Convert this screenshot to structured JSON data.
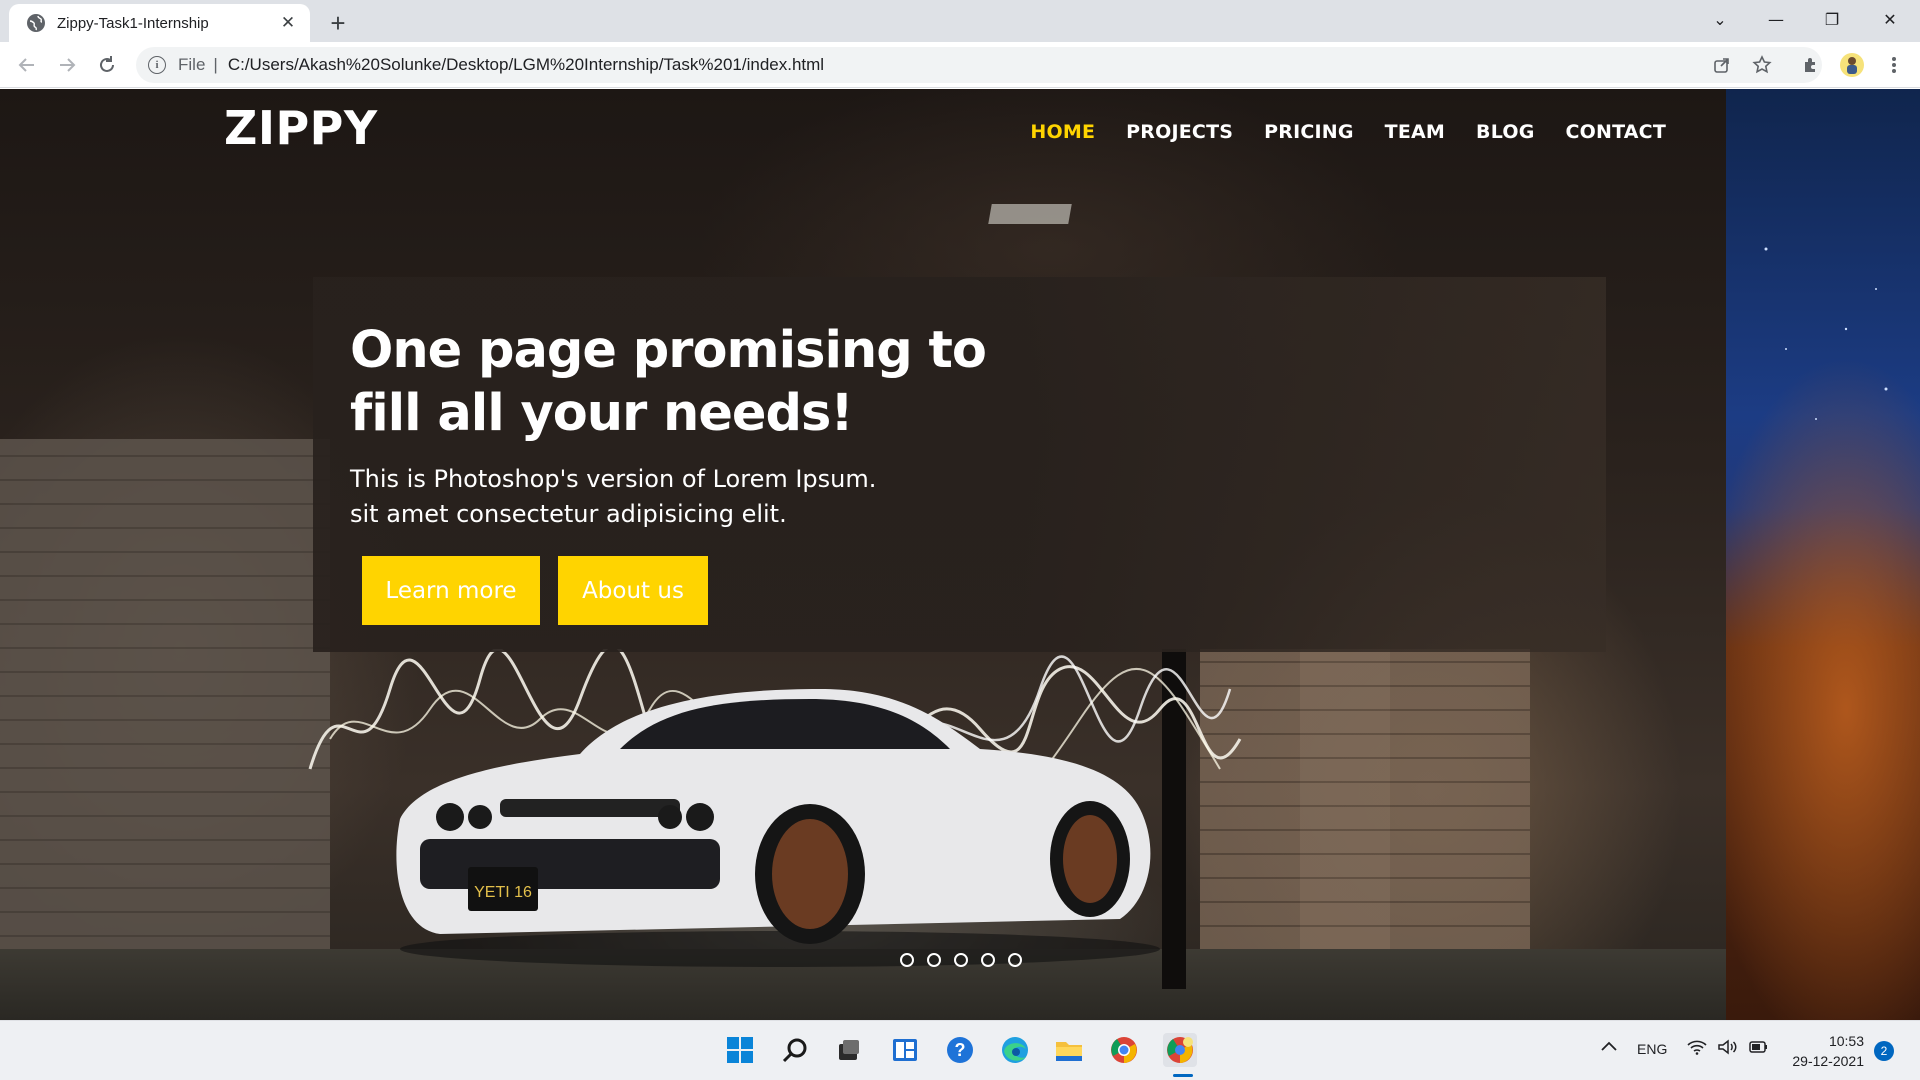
{
  "browser": {
    "tab_title": "Zippy-Task1-Internship",
    "tab_close": "✕",
    "new_tab": "+",
    "window_controls": {
      "dropdown": "⌄",
      "minimize": "—",
      "restore": "❐",
      "close": "✕"
    },
    "address": {
      "scheme_label": "File",
      "separator": "|",
      "url": "C:/Users/Akash%20Solunke/Desktop/LGM%20Internship/Task%201/index.html"
    }
  },
  "site": {
    "logo": "ZIPPY",
    "nav": [
      {
        "label": "HOME",
        "active": true
      },
      {
        "label": "PROJECTS",
        "active": false
      },
      {
        "label": "PRICING",
        "active": false
      },
      {
        "label": "TEAM",
        "active": false
      },
      {
        "label": "BLOG",
        "active": false
      },
      {
        "label": "CONTACT",
        "active": false
      }
    ],
    "hero": {
      "title_line1": "One page promising to",
      "title_line2": "fill all your needs!",
      "sub_line1": "This is Photoshop's version of Lorem Ipsum.",
      "sub_line2": "sit amet consectetur adipisicing elit.",
      "btn_learn": "Learn more",
      "btn_about": "About us"
    },
    "carousel": {
      "dot_count": 5
    },
    "plate_text": "YETI 16",
    "accent_color": "#ffd400"
  },
  "taskbar": {
    "tray_lang": "ENG",
    "time": "10:53",
    "date": "29-12-2021",
    "notifications": "2"
  }
}
